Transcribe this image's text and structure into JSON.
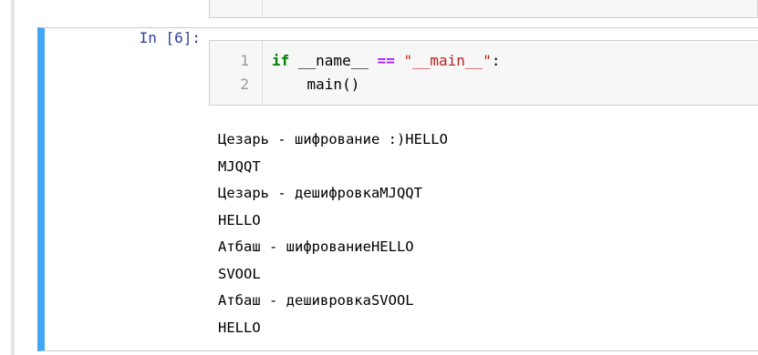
{
  "cell": {
    "prompt": "In [6]:",
    "code_lines": [
      {
        "number": "1",
        "kw_if": "if",
        "var": " __name__ ",
        "op": "==",
        "str": " \"__main__\"",
        "colon": ":"
      },
      {
        "number": "2",
        "text": "    main()"
      }
    ]
  },
  "output": {
    "lines": [
      "Цезарь - шифрование :)HELLO",
      "MJQQT",
      "Цезарь - дешифровкаMJQQT",
      "HELLO",
      "Атбаш - шифрованиеHELLO",
      "SVOOL",
      "Атбаш - дешивровкаSVOOL",
      "HELLO"
    ]
  },
  "colors": {
    "selected_border": "#42a5f5",
    "prompt": "#303f9f",
    "keyword": "#008000",
    "operator": "#aa22ff",
    "string": "#ba2121"
  }
}
